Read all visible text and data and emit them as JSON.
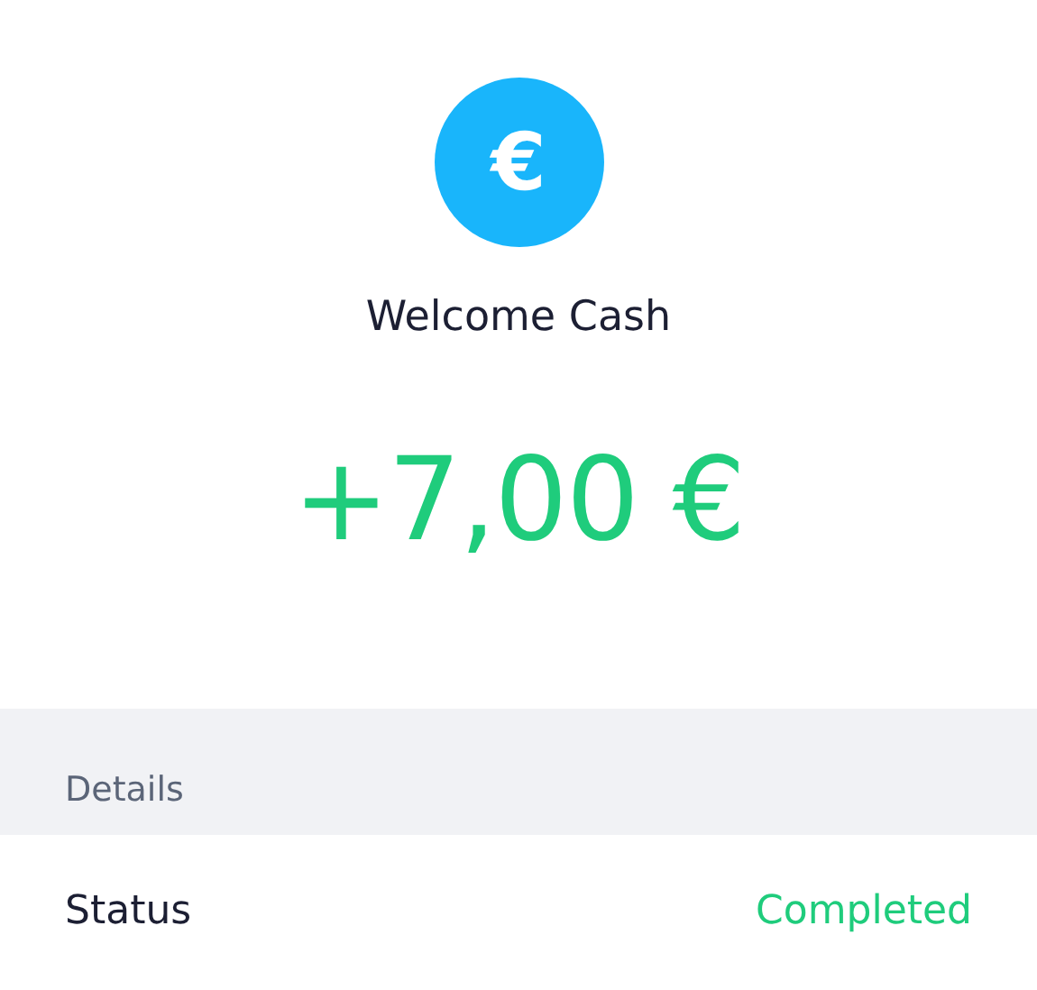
{
  "header": {
    "icon": "€",
    "title": "Welcome Cash"
  },
  "amount": "+7,00 €",
  "details": {
    "heading": "Details",
    "rows": [
      {
        "label": "Status",
        "value": "Completed"
      }
    ]
  }
}
